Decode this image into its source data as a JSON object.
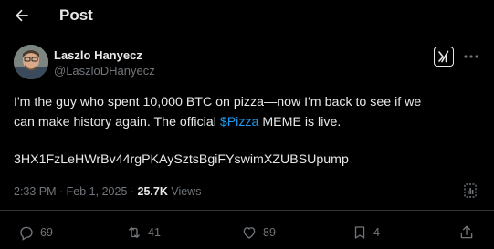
{
  "header": {
    "title": "Post",
    "back_icon": "arrow-left-icon"
  },
  "author": {
    "name": "Laszlo Hanyecz",
    "handle": "@LaszloDHanyecz"
  },
  "post": {
    "line1": "I'm the guy who spent 10,000 BTC on pizza—now I'm back to see if we",
    "line2_before": "can make history again. The official ",
    "cashtag": "$Pizza",
    "line2_after": " MEME is live.",
    "contract": "3HX1FzLeHWrBv44rgPKAySztsBgiFYswimXZUBSUpump"
  },
  "meta": {
    "time": "2:33 PM",
    "date": "Feb 1, 2025",
    "separator": " · ",
    "views_count": "25.7K",
    "views_label": " Views"
  },
  "actions": {
    "replies": "69",
    "reposts": "41",
    "likes": "89",
    "bookmarks": "4"
  },
  "colors": {
    "background": "#000000",
    "text": "#e7e9ea",
    "muted": "#71767b",
    "link": "#1d9bf0",
    "divider": "#2f3336"
  }
}
